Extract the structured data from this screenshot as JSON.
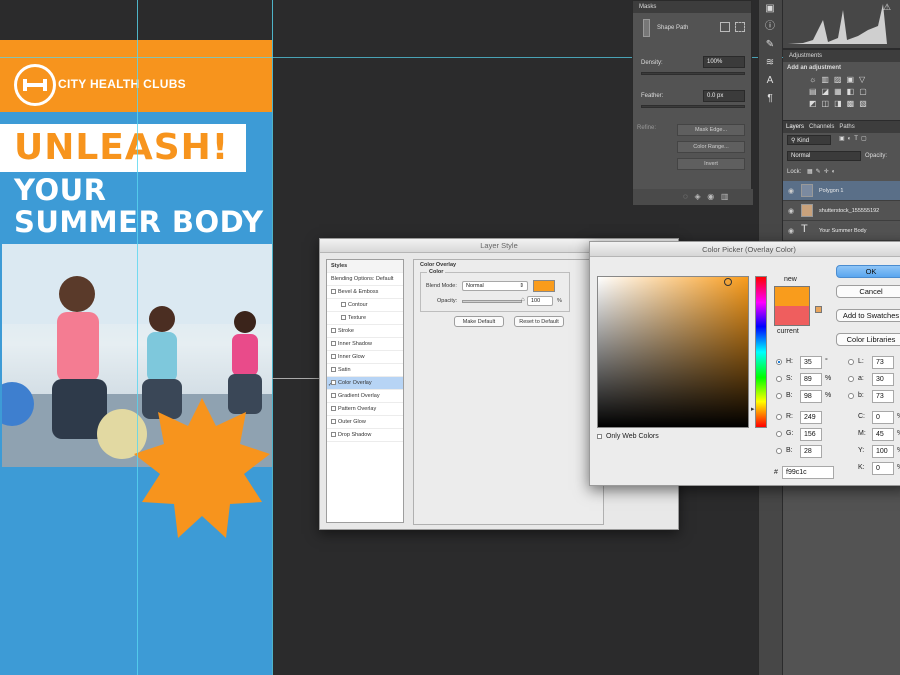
{
  "artboard": {
    "brand": "CITY HEALTH CLUBS",
    "headline1": "UNLEASH!",
    "headline2": "YOUR SUMMER BODY",
    "colors": {
      "orange": "#f7941d",
      "blue": "#3d9bd6"
    }
  },
  "masks_panel": {
    "title": "Masks",
    "shape_label": "Shape Path",
    "density_label": "Density:",
    "density_value": "100%",
    "feather_label": "Feather:",
    "feather_value": "0.0 px",
    "refine_label": "Refine:",
    "mask_edge_button": "Mask Edge...",
    "color_range_button": "Color Range...",
    "invert_button": "Invert"
  },
  "adjustments_panel": {
    "title": "Adjustments",
    "subtitle": "Add an adjustment"
  },
  "layers_panel": {
    "tabs": [
      "Layers",
      "Channels",
      "Paths"
    ],
    "kind_label": "Kind",
    "blend_mode": "Normal",
    "opacity_label": "Opacity:",
    "lock_label": "Lock:",
    "layers": [
      {
        "name": "Polygon 1",
        "selected": true,
        "icon": "shape-thumb"
      },
      {
        "name": "shutterstock_155555192",
        "selected": false,
        "icon": "image-thumb"
      },
      {
        "name": "Your Summer Body",
        "selected": false,
        "icon": "text-T"
      }
    ]
  },
  "layer_style": {
    "title": "Layer Style",
    "styles_header": "Styles",
    "items": [
      {
        "label": "Blending Options: Default",
        "checkbox": false,
        "checked": false,
        "indent": false,
        "selected": false
      },
      {
        "label": "Bevel & Emboss",
        "checkbox": true,
        "checked": false,
        "indent": false,
        "selected": false
      },
      {
        "label": "Contour",
        "checkbox": true,
        "checked": false,
        "indent": true,
        "selected": false
      },
      {
        "label": "Texture",
        "checkbox": true,
        "checked": false,
        "indent": true,
        "selected": false
      },
      {
        "label": "Stroke",
        "checkbox": true,
        "checked": false,
        "indent": false,
        "selected": false
      },
      {
        "label": "Inner Shadow",
        "checkbox": true,
        "checked": false,
        "indent": false,
        "selected": false
      },
      {
        "label": "Inner Glow",
        "checkbox": true,
        "checked": false,
        "indent": false,
        "selected": false
      },
      {
        "label": "Satin",
        "checkbox": true,
        "checked": false,
        "indent": false,
        "selected": false
      },
      {
        "label": "Color Overlay",
        "checkbox": true,
        "checked": true,
        "indent": false,
        "selected": true
      },
      {
        "label": "Gradient Overlay",
        "checkbox": true,
        "checked": false,
        "indent": false,
        "selected": false
      },
      {
        "label": "Pattern Overlay",
        "checkbox": true,
        "checked": false,
        "indent": false,
        "selected": false
      },
      {
        "label": "Outer Glow",
        "checkbox": true,
        "checked": false,
        "indent": false,
        "selected": false
      },
      {
        "label": "Drop Shadow",
        "checkbox": true,
        "checked": false,
        "indent": false,
        "selected": false
      }
    ],
    "overlay": {
      "group_title": "Color Overlay",
      "sub_title": "Color",
      "blend_label": "Blend Mode:",
      "blend_value": "Normal",
      "opacity_label": "Opacity:",
      "opacity_value": "100",
      "opacity_unit": "%",
      "make_default": "Make Default",
      "reset_default": "Reset to Default",
      "swatch_color": "#f99c1c"
    }
  },
  "color_picker": {
    "title": "Color Picker (Overlay Color)",
    "new_label": "new",
    "current_label": "current",
    "new_color": "#f99c1c",
    "current_color": "#ef5e5e",
    "ok": "OK",
    "cancel": "Cancel",
    "add_swatches": "Add to Swatches",
    "color_libraries": "Color Libraries",
    "only_web": "Only Web Colors",
    "hsb": [
      {
        "label": "H:",
        "value": "35",
        "unit": "°",
        "on": true
      },
      {
        "label": "S:",
        "value": "89",
        "unit": "%",
        "on": false
      },
      {
        "label": "B:",
        "value": "98",
        "unit": "%",
        "on": false
      }
    ],
    "rgb": [
      {
        "label": "R:",
        "value": "249"
      },
      {
        "label": "G:",
        "value": "156"
      },
      {
        "label": "B:",
        "value": "28"
      }
    ],
    "lab": [
      {
        "label": "L:",
        "value": "73"
      },
      {
        "label": "a:",
        "value": "30"
      },
      {
        "label": "b:",
        "value": "73"
      }
    ],
    "cmyk": [
      {
        "label": "C:",
        "value": "0",
        "unit": "%"
      },
      {
        "label": "M:",
        "value": "45",
        "unit": "%"
      },
      {
        "label": "Y:",
        "value": "100",
        "unit": "%"
      },
      {
        "label": "K:",
        "value": "0",
        "unit": "%"
      }
    ],
    "hex_label": "#",
    "hex_value": "f99c1c"
  }
}
